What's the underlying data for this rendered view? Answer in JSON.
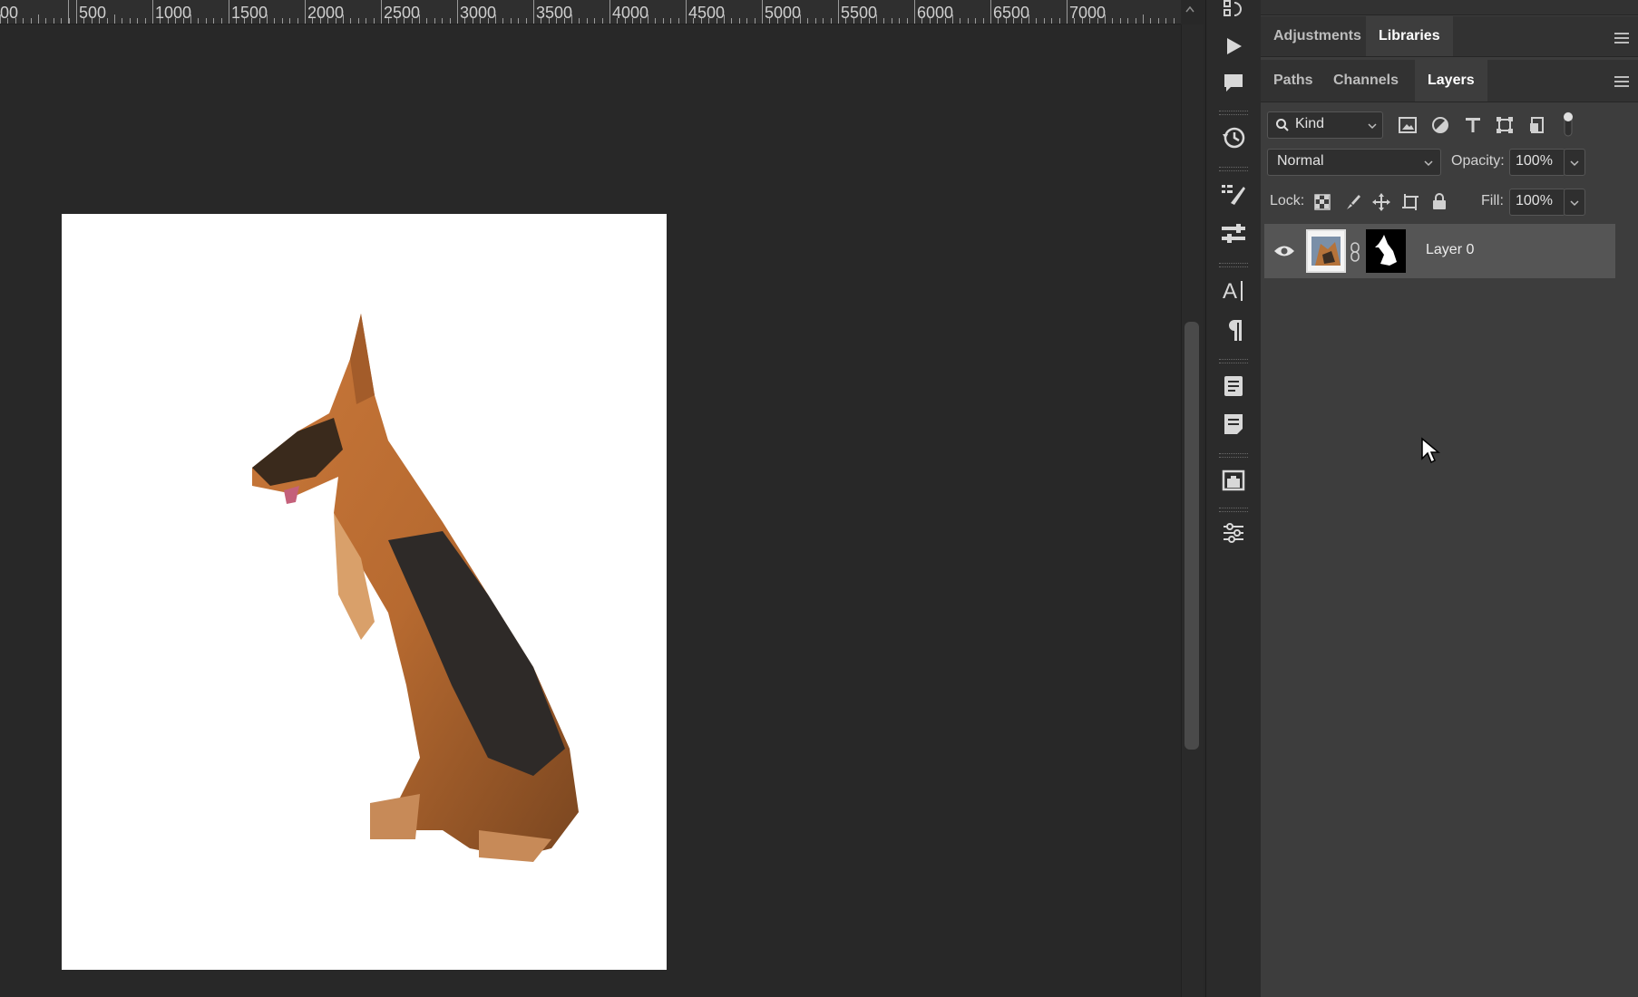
{
  "ruler": {
    "labels": [
      "00",
      "500",
      "1000",
      "1500",
      "2000",
      "2500",
      "3000",
      "3500",
      "4000",
      "4500",
      "5000",
      "5500",
      "6000",
      "6500",
      "7000"
    ]
  },
  "panel_top": {
    "tabs": [
      {
        "label": "Adjustments",
        "active": false
      },
      {
        "label": "Libraries",
        "active": true
      }
    ]
  },
  "layers_panel": {
    "tabs": [
      {
        "label": "Paths",
        "active": false
      },
      {
        "label": "Channels",
        "active": false
      },
      {
        "label": "Layers",
        "active": true
      }
    ],
    "filter": {
      "label": "Kind"
    },
    "blend_mode": "Normal",
    "opacity_label": "Opacity:",
    "opacity_value": "100%",
    "lock_label": "Lock:",
    "fill_label": "Fill:",
    "fill_value": "100%",
    "layers": [
      {
        "name": "Layer 0",
        "visible": true,
        "selected": true
      }
    ]
  },
  "toolstrip": {
    "icons": [
      "adjust-history-icon",
      "play-icon",
      "comment-icon",
      "history-icon",
      "brush-settings-icon",
      "properties-icon",
      "character-icon",
      "paragraph-icon",
      "glyphs-icon",
      "notes-icon",
      "libraries-icon",
      "adjustments-icon"
    ]
  }
}
